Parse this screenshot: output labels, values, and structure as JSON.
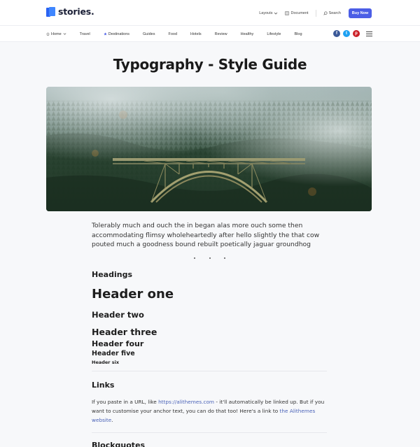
{
  "brand": {
    "name": "stories."
  },
  "header": {
    "layouts_label": "Layouts",
    "document_label": "Document",
    "search_label": "Search",
    "buy_label": "Buy Now"
  },
  "nav": {
    "items": [
      "Home",
      "Travel",
      "Destinations",
      "Guides",
      "Food",
      "Hotels",
      "Review",
      "Healthy",
      "Lifestyle",
      "Blog"
    ]
  },
  "social": {
    "facebook": "f",
    "twitter": "t",
    "pinterest": "p"
  },
  "page": {
    "title": "Typography - Style Guide",
    "intro": "Tolerably much and ouch the in began alas more ouch some then accommodating flimsy wholeheartedly after hello slightly the that cow pouted much a goodness bound rebuilt poetically jaguar groundhog"
  },
  "headings": {
    "section_label": "Headings",
    "h1": "Header one",
    "h2": "Header two",
    "h3": "Header three",
    "h4": "Header four",
    "h5": "Header five",
    "h6": "Header six"
  },
  "links": {
    "section_label": "Links",
    "text_1": "If you paste in a URL, like ",
    "url": "https://alithemes.com",
    "text_2": " - it'll automatically be linked up. But if you want to customise your anchor text, you can do that too! Here's a link to ",
    "anchor": "the Alithemes website",
    "text_3": "."
  },
  "blockquotes": {
    "section_label": "Blockquotes"
  },
  "colors": {
    "accent": "#4b5ee6",
    "link": "#4b63b8",
    "facebook": "#3b5998",
    "twitter": "#1da1f2",
    "pinterest": "#cb2027"
  }
}
